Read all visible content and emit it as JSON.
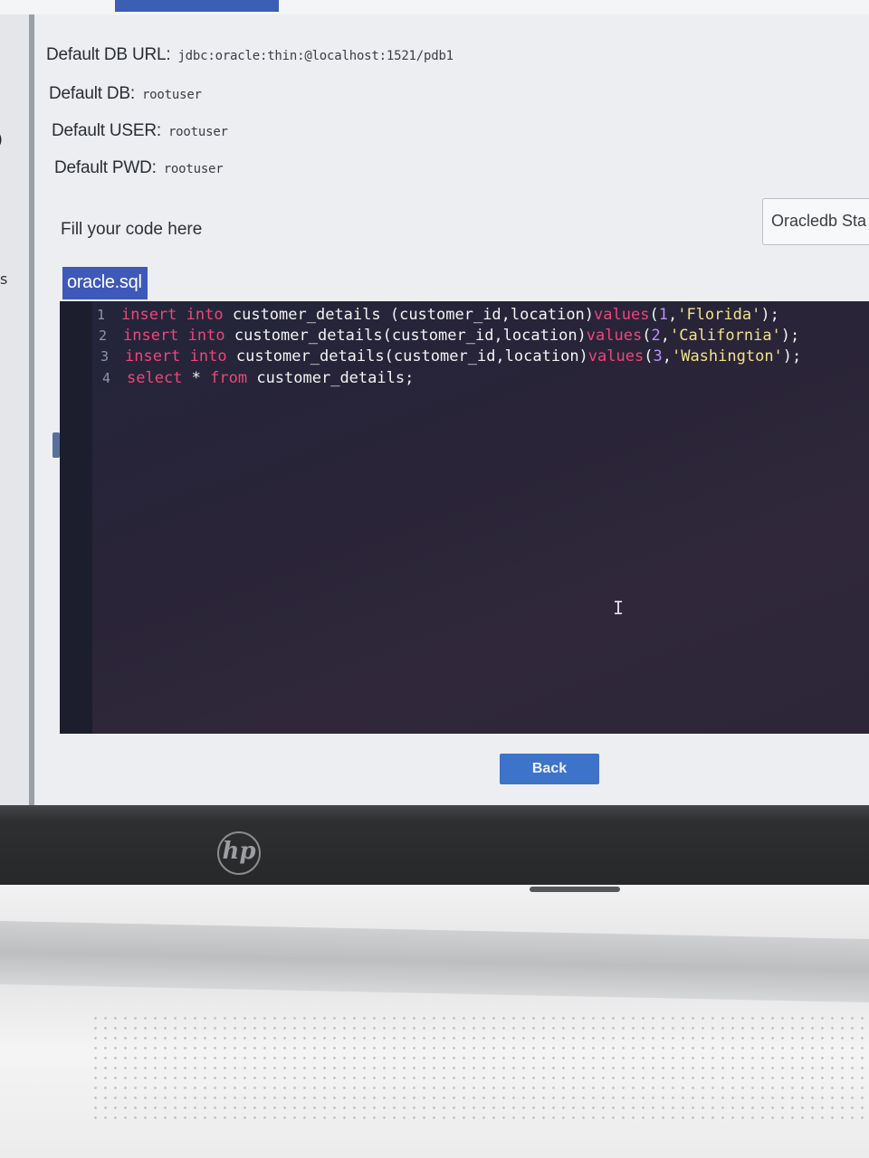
{
  "db_info": {
    "url_label": "Default DB URL:",
    "url_value": "jdbc:oracle:thin:@localhost:1521/pdb1",
    "db_label": "Default DB:",
    "db_value": "rootuser",
    "user_label": "Default USER:",
    "user_value": "rootuser",
    "pwd_label": "Default PWD:",
    "pwd_value": "rootuser"
  },
  "sidebar": {
    "partial_text": "s",
    "marker": ")"
  },
  "editor": {
    "fill_label": "Fill your code here",
    "stack_select_value": "Oracledb Sta",
    "file_tab": "oracle.sql",
    "lines": [
      {
        "n": "1",
        "kw1": "insert",
        "kw2": "into",
        "table": " customer_details (customer_id,location)",
        "fn": "values",
        "open": "(",
        "num": "1",
        "sep": ",",
        "str": "'Florida'",
        "close": ");"
      },
      {
        "n": "2",
        "kw1": "insert",
        "kw2": "into",
        "table": " customer_details(customer_id,location)",
        "fn": "values",
        "open": "(",
        "num": "2",
        "sep": ",",
        "str": "'California'",
        "close": ");"
      },
      {
        "n": "3",
        "kw1": "insert",
        "kw2": "into",
        "table": " customer_details(customer_id,location)",
        "fn": "values",
        "open": "(",
        "num": "3",
        "sep": ",",
        "str": "'Washington'",
        "close": ");"
      },
      {
        "n": "4",
        "kw1": "select",
        "star": " * ",
        "kw2": "from",
        "table": " customer_details;"
      }
    ],
    "cursor_glyph": "I"
  },
  "actions": {
    "back_label": "Back"
  },
  "hardware": {
    "logo_text": "hp"
  },
  "colors": {
    "accent": "#3f59b8",
    "button": "#3d73c9",
    "editor_bg": "#2a2438",
    "keyword": "#f0457a",
    "number": "#b792ff",
    "string": "#f2e28a"
  }
}
